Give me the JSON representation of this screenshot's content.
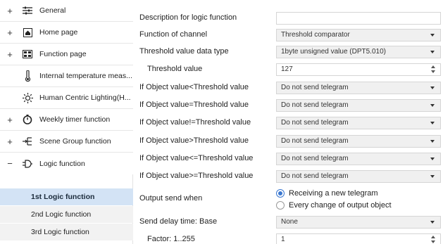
{
  "sidebar": {
    "items": [
      {
        "label": "General",
        "expander": "+",
        "icon": "sliders-icon"
      },
      {
        "label": "Home page",
        "expander": "+",
        "icon": "home-icon"
      },
      {
        "label": "Function page",
        "expander": "+",
        "icon": "grid-icon"
      },
      {
        "label": "Internal temperature meas...",
        "expander": "",
        "icon": "thermometer-icon"
      },
      {
        "label": "Human Centric Lighting(H...",
        "expander": "",
        "icon": "sun-icon"
      },
      {
        "label": "Weekly timer function",
        "expander": "+",
        "icon": "clock-icon"
      },
      {
        "label": "Scene Group function",
        "expander": "+",
        "icon": "scene-icon"
      },
      {
        "label": "Logic function",
        "expander": "−",
        "icon": "logic-icon"
      }
    ],
    "subitems": [
      {
        "label": "1st Logic function",
        "active": true
      },
      {
        "label": "2nd Logic function",
        "active": false
      },
      {
        "label": "3rd Logic function",
        "active": false
      }
    ]
  },
  "form": {
    "description": {
      "label": "Description for logic function",
      "value": ""
    },
    "function_channel": {
      "label": "Function of channel",
      "value": "Threshold comparator"
    },
    "threshold_type": {
      "label": "Threshold value data type",
      "value": "1byte unsigned value (DPT5.010)"
    },
    "threshold_value": {
      "label": "Threshold value",
      "value": "127"
    },
    "obj_lt": {
      "label": "If Object value<Threshold value",
      "value": "Do not send telegram"
    },
    "obj_eq": {
      "label": "If Object value=Threshold value",
      "value": "Do not send telegram"
    },
    "obj_ne": {
      "label": "If Object value!=Threshold value",
      "value": "Do not send telegram"
    },
    "obj_gt": {
      "label": "If Object value>Threshold value",
      "value": "Do not send telegram"
    },
    "obj_le": {
      "label": "If Object value<=Threshold value",
      "value": "Do not send telegram"
    },
    "obj_ge": {
      "label": "If Object value>=Threshold value",
      "value": "Do not send telegram"
    },
    "output_send": {
      "label": "Output send when",
      "options": [
        "Receiving a new telegram",
        "Every change of output object"
      ],
      "selected": 0
    },
    "delay_base": {
      "label": "Send delay time: Base",
      "value": "None"
    },
    "factor": {
      "label": "Factor: 1..255",
      "value": "1"
    }
  },
  "colors": {
    "accent": "#3b78d0",
    "active_bg": "#d3e3f5",
    "field_bg": "#f0f0f0"
  }
}
